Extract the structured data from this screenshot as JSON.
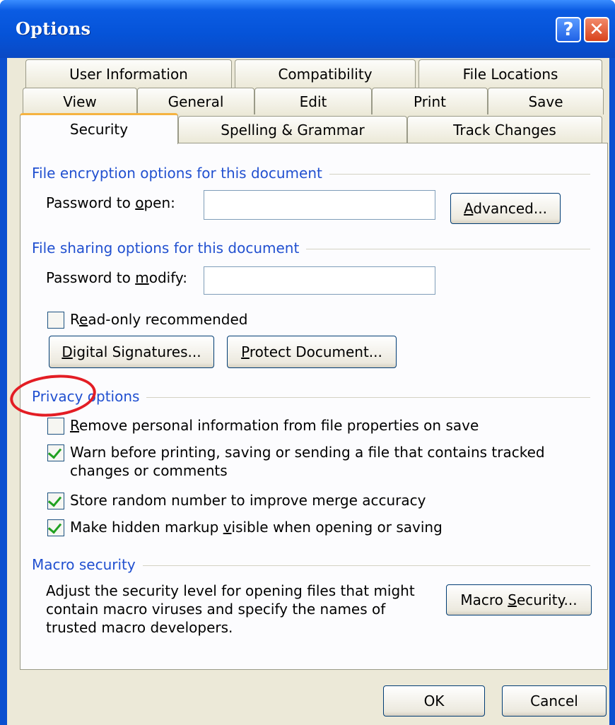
{
  "window": {
    "title": "Options"
  },
  "title_buttons": {
    "help": "?",
    "close": "✕"
  },
  "tabs": {
    "row1": [
      "User Information",
      "Compatibility",
      "File Locations"
    ],
    "row2": [
      "View",
      "General",
      "Edit",
      "Print",
      "Save"
    ],
    "row3": [
      "Security",
      "Spelling & Grammar",
      "Track Changes"
    ],
    "active": "Security"
  },
  "encryption": {
    "title": "File encryption options for this document",
    "password_open_label": {
      "pre": "Password to ",
      "u": "o",
      "post": "pen:"
    },
    "password_open_value": "",
    "advanced_button": {
      "pre": "",
      "u": "A",
      "post": "dvanced..."
    }
  },
  "sharing": {
    "title": "File sharing options for this document",
    "password_modify_label": {
      "pre": "Password to ",
      "u": "m",
      "post": "odify:"
    },
    "password_modify_value": "",
    "read_only": {
      "pre": "R",
      "u": "e",
      "post": "ad-only recommended",
      "checked": false
    },
    "digital_signatures_button": {
      "pre": "",
      "u": "D",
      "post": "igital Signatures..."
    },
    "protect_document_button": {
      "pre": "",
      "u": "P",
      "post": "rotect Document..."
    }
  },
  "privacy": {
    "title": "Privacy options",
    "remove_personal": {
      "pre": "",
      "u": "R",
      "post": "emove personal information from file properties on save",
      "checked": false
    },
    "warn_before": {
      "line1": "Warn before printing, saving or sending a file that contains tracked",
      "line2": "changes or comments",
      "checked": true
    },
    "store_random": {
      "text": "Store random number to improve merge accuracy",
      "checked": true
    },
    "make_hidden": {
      "pre": "Make hidden markup ",
      "u": "v",
      "post": "isible when opening or saving",
      "checked": true
    }
  },
  "macro": {
    "title": "Macro security",
    "description": [
      "Adjust the security level for opening files that might",
      "contain macro viruses and specify the names of",
      "trusted macro developers."
    ],
    "macro_button": {
      "pre": "Macro ",
      "u": "S",
      "post": "ecurity..."
    }
  },
  "footer": {
    "ok": "OK",
    "cancel": "Cancel"
  },
  "colors": {
    "title_bar": "#0553d8",
    "group_title": "#2150d0",
    "annotation": "#e31d24",
    "active_tab_accent": "#f5b340"
  }
}
